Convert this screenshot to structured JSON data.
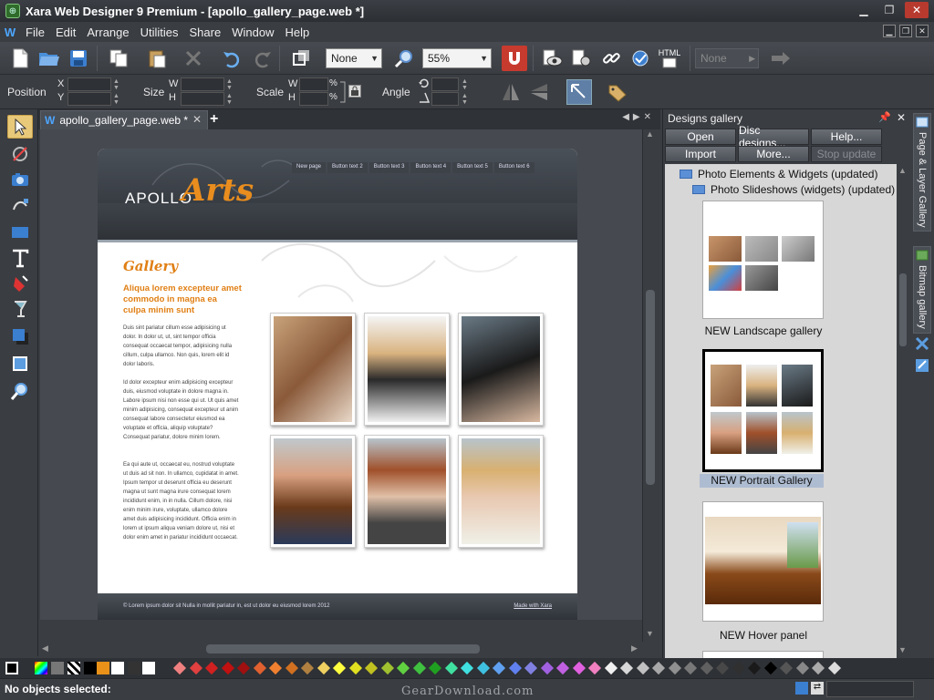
{
  "window": {
    "title": "Xara Web Designer 9 Premium - [apollo_gallery_page.web *]"
  },
  "menu": [
    "File",
    "Edit",
    "Arrange",
    "Utilities",
    "Share",
    "Window",
    "Help"
  ],
  "toolbar": {
    "feather_value": "None",
    "zoom_value": "55%",
    "html_label": "HTML",
    "right_select_value": "None"
  },
  "infobar": {
    "position_label": "Position",
    "x_label": "X",
    "y_label": "Y",
    "size_label": "Size",
    "w_label": "W",
    "h_label": "H",
    "scale_label": "Scale",
    "scale_w_label": "W",
    "scale_h_label": "H",
    "percent": "%",
    "angle_label": "Angle"
  },
  "document_tab": {
    "icon": "W",
    "label": "apollo_gallery_page.web *"
  },
  "webpage": {
    "logo_prefix": "APOLLO",
    "logo_suffix": "Arts",
    "nav": [
      "New page",
      "Button text 2",
      "Button text 3",
      "Button text 4",
      "Button text 5",
      "Button text 6"
    ],
    "heading": "Gallery",
    "subheading": "Aliqua lorem excepteur amet commodo in magna ea culpa minim sunt",
    "para1": "Duis sint pariatur cillum esse adipisicing ut dolor. In dolor ut, ut, sint tempor officia consequat occaecat tempor, adipisicing nulla cillum, culpa ullamco. Non quis, lorem elit id dolor laboris.",
    "para2": "Id dolor excepteur enim adipisicing excepteur duis, eiusmod voluptate in dolore magna in. Labore ipsum nisi non esse qui ut. Ut quis amet minim adipisicing, consequat excepteur ut anim consequat labore consectetur eiusmod ea voluptate et officia, aliquip voluptate? Consequat pariatur, dolore minim lorem.",
    "para3": "Ea qui aute ut, occaecat eu, nostrud voluptate ut duis ad sit non. In ullamco, cupidatat in amet. Ipsum tempor ut deserunt officia eu deserunt magna ut sunt magna irure consequat lorem incididunt enim, in in nulla. Cillum dolore, nisi enim minim irure, voluptate, ullamco dolore amet duis adipisicing incididunt. Officia enim in lorem ut ipsum aliqua veniam dolore ut, nisi et dolor enim amet in pariatur incididunt occaecat.",
    "footer_left": "© Lorem ipsum dolor sit Nulla in mollit pariatur in, est ut dolor eu eiusmod lorem 2012",
    "footer_right": "Made with Xara"
  },
  "gallery": {
    "title": "Designs gallery",
    "buttons": {
      "open": "Open",
      "disc": "Disc designs...",
      "help": "Help...",
      "import": "Import",
      "more": "More...",
      "stop": "Stop update"
    },
    "folder1": "Photo Elements & Widgets (updated)",
    "folder2": "Photo Slideshows (widgets) (updated)",
    "items": [
      "NEW Landscape gallery",
      "NEW Portrait Gallery",
      "NEW Hover panel"
    ]
  },
  "side_tabs": [
    "Page & Layer Gallery",
    "Bitmap gallery"
  ],
  "status": {
    "text": "No objects selected:",
    "watermark": "GearDownload.com"
  },
  "colors": {
    "accent": "#e98d1e",
    "selected_tool": "#e8c97a",
    "window_bg": "#3a3d42"
  }
}
